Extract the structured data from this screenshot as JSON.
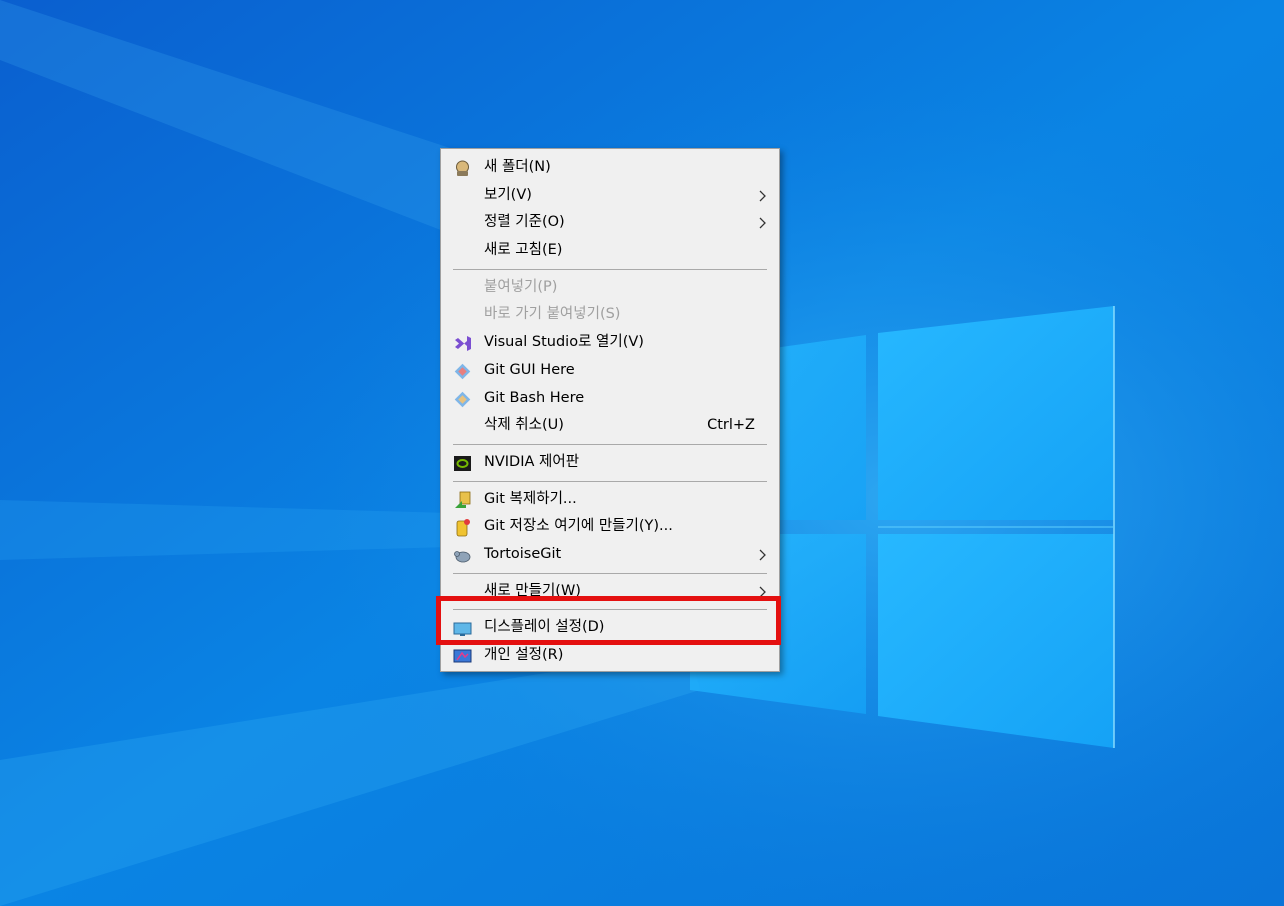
{
  "menu": {
    "items": [
      {
        "id": "new-folder",
        "label": "새 폴더(N)",
        "icon": "new-folder-icon",
        "disabled": false
      },
      {
        "id": "view",
        "label": "보기(V)",
        "submenu": true
      },
      {
        "id": "sort-by",
        "label": "정렬 기준(O)",
        "submenu": true
      },
      {
        "id": "refresh",
        "label": "새로 고침(E)"
      },
      {
        "id": "paste",
        "label": "붙여넣기(P)",
        "disabled": true
      },
      {
        "id": "paste-shortcut",
        "label": "바로 가기 붙여넣기(S)",
        "disabled": true
      },
      {
        "id": "open-visual-studio",
        "label": "Visual Studio로 열기(V)",
        "icon": "visual-studio-icon"
      },
      {
        "id": "git-gui-here",
        "label": "Git GUI Here",
        "icon": "git-icon"
      },
      {
        "id": "git-bash-here",
        "label": "Git Bash Here",
        "icon": "git-icon"
      },
      {
        "id": "undo-delete",
        "label": "삭제 취소(U)",
        "shortcut": "Ctrl+Z"
      },
      {
        "id": "nvidia-control-panel",
        "label": "NVIDIA 제어판",
        "icon": "nvidia-icon"
      },
      {
        "id": "git-clone",
        "label": "Git 복제하기...",
        "icon": "tortoisegit-clone-icon"
      },
      {
        "id": "git-create-repo",
        "label": "Git 저장소 여기에 만들기(Y)...",
        "icon": "tortoisegit-repo-icon"
      },
      {
        "id": "tortoisegit",
        "label": "TortoiseGit",
        "icon": "tortoisegit-icon",
        "submenu": true
      },
      {
        "id": "new",
        "label": "새로 만들기(W)",
        "submenu": true
      },
      {
        "id": "display-settings",
        "label": "디스플레이 설정(D)",
        "icon": "display-icon"
      },
      {
        "id": "personalize",
        "label": "개인 설정(R)",
        "icon": "personalize-icon"
      }
    ]
  },
  "colors": {
    "highlight": "#e41010",
    "menu_bg": "#f0f0f0",
    "disabled_text": "#a0a0a0"
  }
}
